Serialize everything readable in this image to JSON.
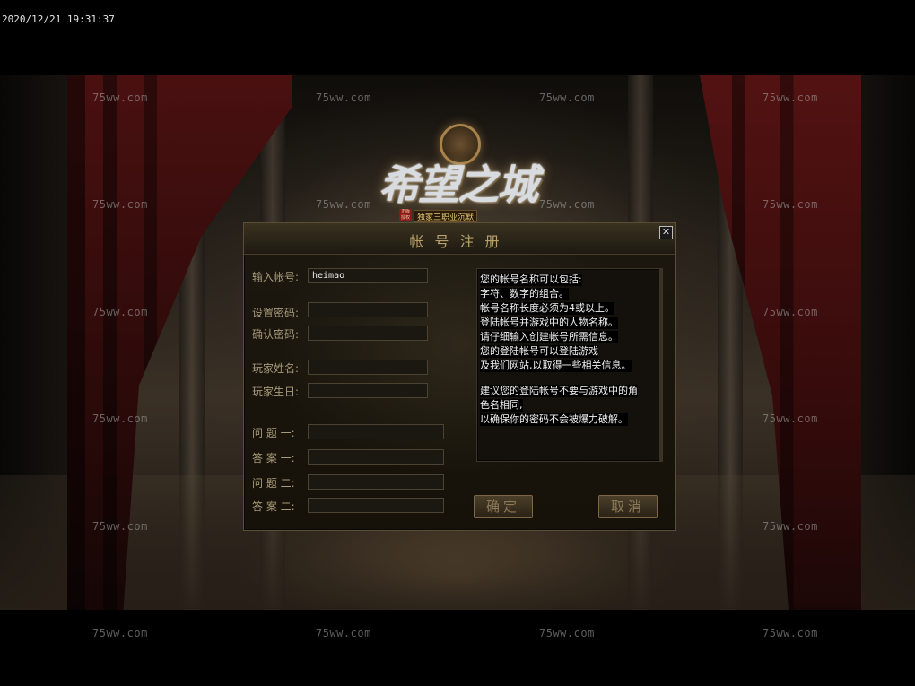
{
  "timestamp": "2020/12/21 19:31:37",
  "watermark": "75ww.com",
  "logo": {
    "title": "希望之城",
    "subtitle": "独家三职业沉默",
    "stamp": "正版授权"
  },
  "dialog": {
    "title": "帐号注册",
    "close_symbol": "✕",
    "fields": {
      "account": {
        "label": "输入帐号:",
        "value": "heimao"
      },
      "password": {
        "label": "设置密码:",
        "value": ""
      },
      "confirm": {
        "label": "确认密码:",
        "value": ""
      },
      "player_name": {
        "label": "玩家姓名:",
        "value": ""
      },
      "birthday": {
        "label": "玩家生日:",
        "value": ""
      },
      "question1": {
        "label": "问 题 一:",
        "value": ""
      },
      "answer1": {
        "label": "答 案 一:",
        "value": ""
      },
      "question2": {
        "label": "问 题 二:",
        "value": ""
      },
      "answer2": {
        "label": "答 案 二:",
        "value": ""
      }
    },
    "info_lines": [
      "您的帐号名称可以包括:",
      "字符、数字的组合。",
      "帐号名称长度必须为4或以上。",
      "登陆帐号并游戏中的人物名称。",
      "请仔细输入创建帐号所需信息。",
      "您的登陆帐号可以登陆游戏",
      "及我们网站,以取得一些相关信息。",
      "",
      "建议您的登陆帐号不要与游戏中的角",
      "色名相同,",
      "以确保你的密码不会被爆力破解。"
    ],
    "confirm_button": "确定",
    "cancel_button": "取消"
  }
}
